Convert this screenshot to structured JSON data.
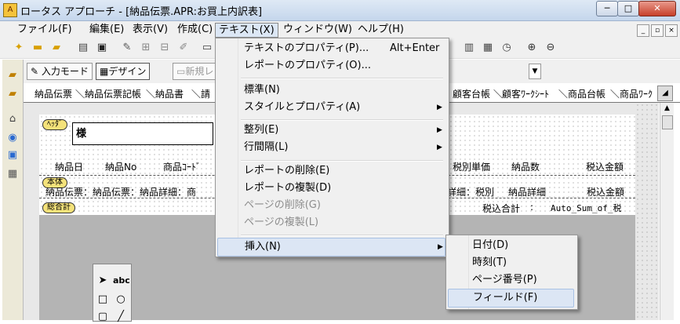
{
  "window": {
    "title": "ロータス アプローチ - [納品伝票.APR:お買上内訳表]",
    "app_icon_glyph": "A",
    "min_glyph": "─",
    "max_glyph": "□",
    "close_glyph": "✕"
  },
  "menubar": {
    "items": [
      {
        "label": "ファイル(F)"
      },
      {
        "label": "編集(E)"
      },
      {
        "label": "表示(V)"
      },
      {
        "label": "作成(C)"
      },
      {
        "label": "テキスト(X)"
      },
      {
        "label": "ウィンドウ(W)"
      },
      {
        "label": "ヘルプ(H)"
      }
    ],
    "mdi_min": "_",
    "mdi_restore": "▫",
    "mdi_close": "×"
  },
  "toolbar_icons": [
    "new-file-icon",
    "open-folder-icon",
    "save-icon",
    "print-icon",
    "preview-icon",
    "edit-pencil-icon",
    "chart-icon",
    "draw-icon",
    "text-tool-icon",
    "page-icon",
    "calendar-icon",
    "clock-icon",
    "zoom-in-icon",
    "zoom-out-icon"
  ],
  "modebar": {
    "input_mode": "入力モード",
    "design": "デザイン",
    "new_label": "新規レ"
  },
  "tabs": {
    "left": [
      "納品伝票",
      "納品伝票記帳",
      "納品書",
      "請"
    ],
    "right": [
      "顧客台帳",
      "顧客ﾜｰｸｼｰﾄ",
      "商品台帳",
      "商品ﾜｰｸ"
    ]
  },
  "report": {
    "header_band": "ﾍｯﾀﾞ",
    "header_text": "様",
    "body_band": "本体",
    "summary_band": "総合計",
    "columns_left": [
      "納品日",
      "納品No",
      "商品ｺｰﾄﾞ"
    ],
    "columns_right": [
      "税別単価",
      "納品数",
      "税込金額"
    ],
    "row_left": "納品伝票：納品伝票：納品詳細：商",
    "row_right": "詳細：税別",
    "row_right2": "納品詳細",
    "row_amount": "税込金額",
    "summary_label": "税込合計",
    "summary_colon": ":",
    "summary_value": "Auto_Sum_of_税"
  },
  "text_menu": {
    "items": [
      {
        "label": "テキストのプロパティ(P)...",
        "shortcut": "Alt+Enter"
      },
      {
        "label": "レポートのプロパティ(O)..."
      },
      {
        "label": "標準(N)"
      },
      {
        "label": "スタイルとプロパティ(A)"
      },
      {
        "label": "整列(E)"
      },
      {
        "label": "行間隔(L)"
      },
      {
        "label": "レポートの削除(E)"
      },
      {
        "label": "レポートの複製(D)"
      },
      {
        "label": "ページの削除(G)"
      },
      {
        "label": "ページの複製(L)"
      },
      {
        "label": "挿入(N)"
      }
    ]
  },
  "insert_menu": {
    "items": [
      {
        "label": "日付(D)"
      },
      {
        "label": "時刻(T)"
      },
      {
        "label": "ページ番号(P)"
      },
      {
        "label": "フィールド(F)"
      }
    ]
  },
  "tool_palette": {
    "text_tool": "abc"
  }
}
